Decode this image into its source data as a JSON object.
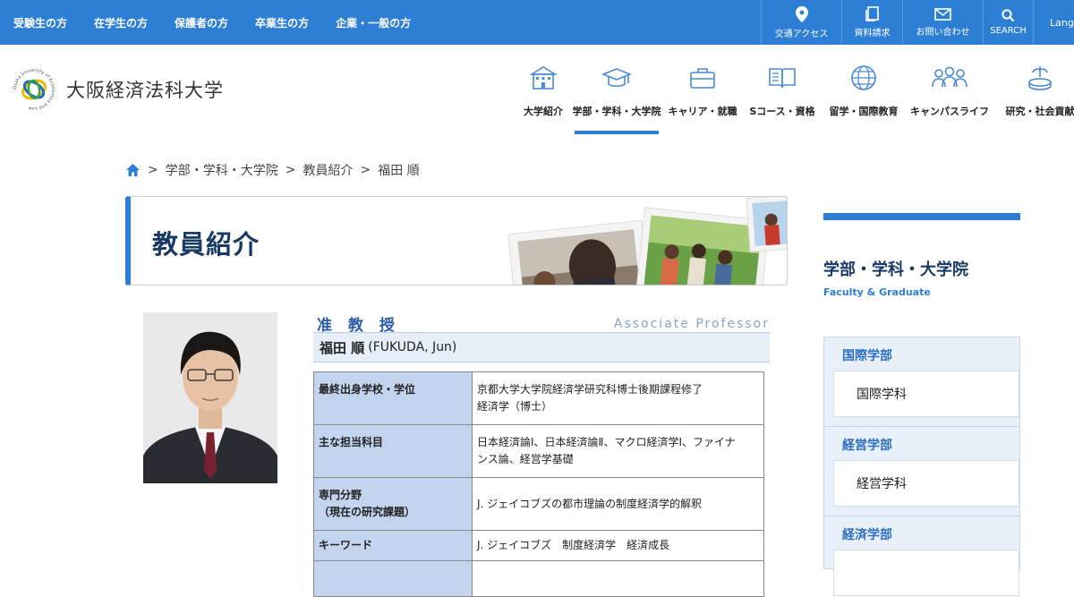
{
  "audience_nav": [
    "受験生の方",
    "在学生の方",
    "保護者の方",
    "卒業生の方",
    "企業・一般の方"
  ],
  "tools": {
    "access": "交通アクセス",
    "materials": "資料請求",
    "contact": "お問い合わせ",
    "search": "SEARCH",
    "lang": "Lang"
  },
  "site": {
    "logo_text": "大阪経済法科大学",
    "logo_ring_text": "Osaka University of Economics and Law"
  },
  "global_nav": [
    {
      "label": "大学紹介",
      "icon": "building-icon"
    },
    {
      "label": "学部・学科・大学院",
      "icon": "graduation-cap-icon"
    },
    {
      "label": "キャリア・就職",
      "icon": "briefcase-icon"
    },
    {
      "label": "Sコース・資格",
      "icon": "book-icon"
    },
    {
      "label": "留学・国際教育",
      "icon": "globe-icon"
    },
    {
      "label": "キャンパスライフ",
      "icon": "people-icon"
    },
    {
      "label": "研究・社会貢献",
      "icon": "fountain-icon"
    }
  ],
  "breadcrumb": [
    "学部・学科・大学院",
    "教員紹介",
    "福田 順"
  ],
  "page_title": "教員紹介",
  "profile": {
    "rank_ja": "准 教 授",
    "rank_en": "Associate Professor",
    "name_ja": "福田 順",
    "name_en": "(FUKUDA, Jun)",
    "rows": [
      {
        "label": "最終出身学校・学位",
        "value_lines": [
          "京都大学大学院経済学研究科博士後期課程修了",
          "経済学（博士）"
        ]
      },
      {
        "label": "主な担当科目",
        "value_lines": [
          "日本経済論Ⅰ、日本経済論Ⅱ、マクロ経済学Ⅰ、ファイナ",
          "ンス論、経営学基礎"
        ]
      },
      {
        "label": "専門分野",
        "label2": "（現在の研究課題）",
        "value_lines": [
          "J. ジェイコブズの都市理論の制度経済学的解釈"
        ]
      },
      {
        "label": "キーワード",
        "value_lines": [
          "J. ジェイコブズ　制度経済学　経済成長"
        ]
      }
    ]
  },
  "sidebar": {
    "title": "学部・学科・大学院",
    "subtitle": "Faculty & Graduate",
    "groups": [
      {
        "label": "国際学部",
        "child": "国際学科"
      },
      {
        "label": "経営学部",
        "child": "経営学科"
      },
      {
        "label": "経済学部",
        "child": ""
      }
    ]
  },
  "colors": {
    "brand_blue": "#2d7fd6",
    "navy": "#1a3a66",
    "table_header": "#c3d4ee"
  }
}
